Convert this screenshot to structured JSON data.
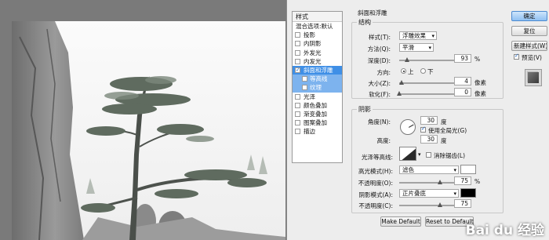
{
  "styles_panel": {
    "header": "样式",
    "blend_options": "混合选项:默认",
    "items": [
      {
        "label": "投影",
        "checked": false
      },
      {
        "label": "内阴影",
        "checked": false
      },
      {
        "label": "外发光",
        "checked": false
      },
      {
        "label": "内发光",
        "checked": false
      },
      {
        "label": "斜面和浮雕",
        "checked": true,
        "selected": true
      },
      {
        "label": "等高线",
        "checked": false,
        "sub": true
      },
      {
        "label": "纹理",
        "checked": false,
        "sub": true
      },
      {
        "label": "光泽",
        "checked": false
      },
      {
        "label": "颜色叠加",
        "checked": false
      },
      {
        "label": "渐变叠加",
        "checked": false
      },
      {
        "label": "图案叠加",
        "checked": false
      },
      {
        "label": "描边",
        "checked": false
      }
    ]
  },
  "bevel": {
    "title": "斜面和浮雕",
    "structure_title": "结构",
    "style_label": "样式(T):",
    "style_value": "浮雕效果",
    "technique_label": "方法(Q):",
    "technique_value": "平滑",
    "depth_label": "深度(D):",
    "depth_value": "93",
    "depth_unit": "%",
    "direction_label": "方向:",
    "direction_up": "上",
    "direction_down": "下",
    "size_label": "大小(Z):",
    "size_value": "4",
    "size_unit": "像素",
    "soften_label": "软化(F):",
    "soften_value": "0",
    "soften_unit": "像素"
  },
  "shading": {
    "title": "阴影",
    "angle_label": "角度(N):",
    "angle_value": "30",
    "angle_unit": "度",
    "global_light_label": "使用全局光(G)",
    "altitude_label": "高度:",
    "altitude_value": "30",
    "altitude_unit": "度",
    "gloss_label": "光泽等高线:",
    "anti_alias_label": "消除锯齿(L)",
    "highlight_mode_label": "高光模式(H):",
    "highlight_mode_value": "滤色",
    "highlight_opacity_label": "不透明度(O):",
    "highlight_opacity_value": "75",
    "shadow_mode_label": "阴影模式(A):",
    "shadow_mode_value": "正片叠底",
    "shadow_opacity_label": "不透明度(C):",
    "shadow_opacity_value": "75",
    "percent": "%"
  },
  "footer": {
    "make_default": "Make Default",
    "reset_default": "Reset to Default"
  },
  "buttons": {
    "ok": "确定",
    "reset": "复位",
    "new_style": "新建样式(W)...",
    "preview": "预览(V)"
  },
  "watermark": "Bai du 经验",
  "colors": {
    "selected": "#3f8fe6",
    "highlight_swatch": "#ffffff",
    "shadow_swatch": "#000000"
  }
}
